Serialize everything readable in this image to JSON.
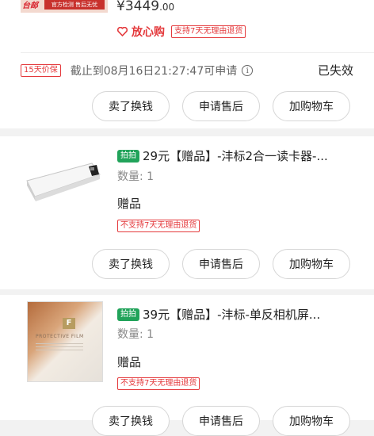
{
  "order_top": {
    "thumb_brand": "台邮",
    "thumb_badge": "官方检测 售后无忧",
    "price_main": "¥3449",
    "price_cents": ".00",
    "fangxingou_label": "放心购",
    "fangxingou_tag": "支持7天无理由退货"
  },
  "protection": {
    "badge": "15天价保",
    "deadline_text": "截止到08月16日21:27:47可申请",
    "info_icon_glyph": "i",
    "status": "已失效"
  },
  "actions": {
    "sell_label": "卖了换钱",
    "after_sale_label": "申请售后",
    "add_cart_label": "加购物车"
  },
  "items": [
    {
      "pinpin_label": "拍拍",
      "title": "29元【赠品】-沣标2合一读卡器-...",
      "qty": "数量: 1",
      "type_label": "赠品",
      "tag": "不支持7天无理由退货"
    },
    {
      "pinpin_label": "拍拍",
      "title": "39元【赠品】-沣标-单反相机屏...",
      "qty": "数量: 1",
      "type_label": "赠品",
      "tag": "不支持7天无理由退货",
      "thumb_logo": "F",
      "thumb_text": "PROTECTIVE FILM"
    }
  ],
  "colors": {
    "accent_red": "#e4393c",
    "pinpin_green": "#21a35a",
    "background": "#f2f2f2"
  }
}
